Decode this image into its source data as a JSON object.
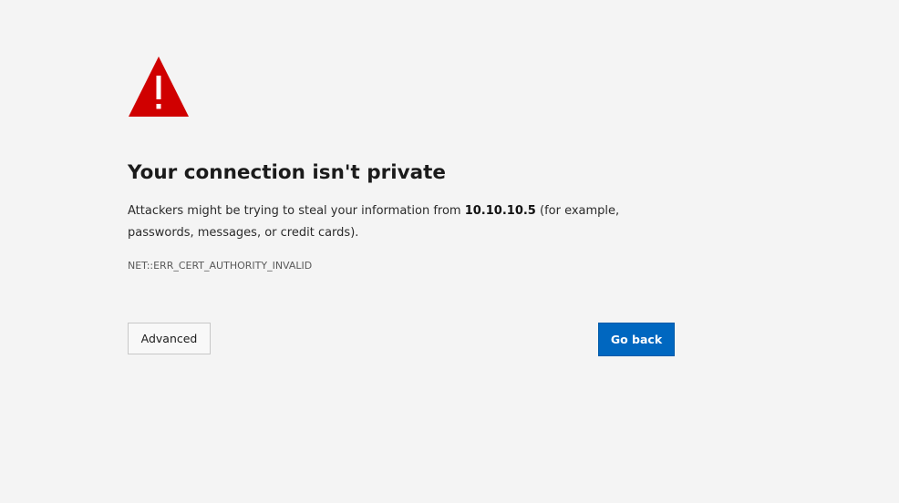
{
  "page": {
    "icon": "warning-triangle-icon",
    "icon_color": "#d00000",
    "title": "Your connection isn't private",
    "message": {
      "before_host": "Attackers might be trying to steal your information from ",
      "host": "10.10.10.5",
      "after_host": " (for example, passwords, messages, or credit cards)."
    },
    "error_code": "NET::ERR_CERT_AUTHORITY_INVALID"
  },
  "buttons": {
    "advanced_label": "Advanced",
    "go_back_label": "Go back",
    "go_back_color": "#0067c0"
  }
}
